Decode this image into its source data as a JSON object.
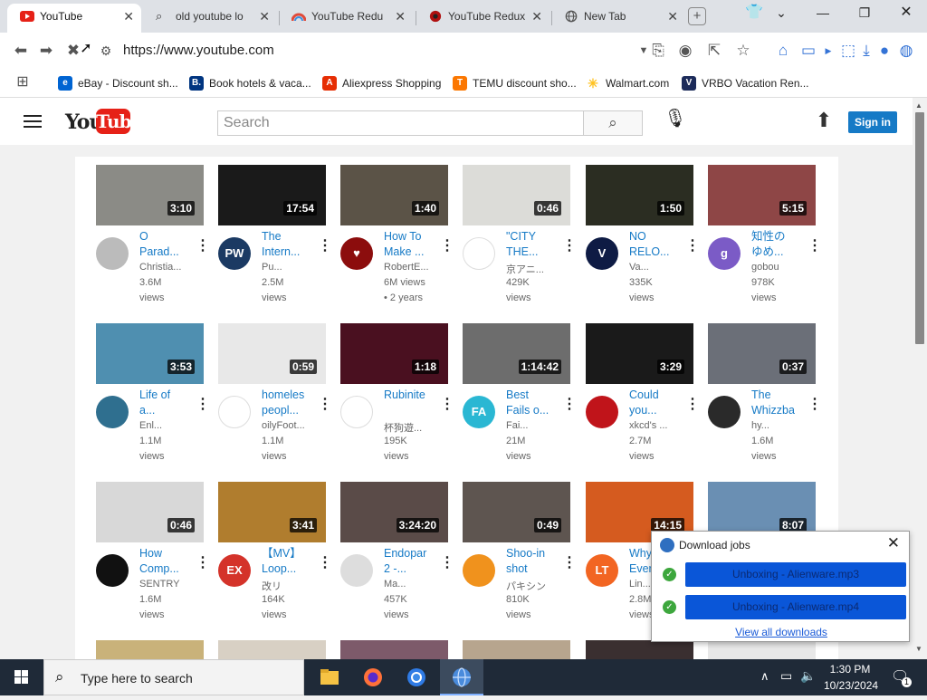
{
  "browser": {
    "tabs": [
      {
        "label": "YouTube",
        "active": true
      },
      {
        "label": "old youtube lo"
      },
      {
        "label": "YouTube Redu"
      },
      {
        "label": "YouTube Redux"
      },
      {
        "label": "New Tab"
      }
    ],
    "url": "https://www.youtube.com",
    "bookmarks": [
      {
        "label": "eBay - Discount sh...",
        "icon": "ebay-icon",
        "color": "#0064d2"
      },
      {
        "label": "Book hotels & vaca...",
        "icon": "booking-icon",
        "color": "#003580"
      },
      {
        "label": "Aliexpress Shopping",
        "icon": "aliexpress-icon",
        "color": "#e62e04"
      },
      {
        "label": "TEMU discount sho...",
        "icon": "temu-icon",
        "color": "#fb7701"
      },
      {
        "label": "Walmart.com",
        "icon": "walmart-icon",
        "color": "#ffc220"
      },
      {
        "label": "VRBO Vacation Ren...",
        "icon": "vrbo-icon",
        "color": "#1c2b5a"
      }
    ]
  },
  "youtube": {
    "logo_you": "You",
    "logo_tube": "Tube",
    "search_placeholder": "Search",
    "signin_label": "Sign in",
    "videos": [
      {
        "duration": "3:10",
        "title": "O\nParad...",
        "channel": "Christia...",
        "views": "3.6M",
        "views2": "views",
        "thumb": "#8b8b86",
        "avatar": "#bbbbbb",
        "avatar_text": ""
      },
      {
        "duration": "17:54",
        "title": "The\nIntern...",
        "channel": "Pu...",
        "views": "2.5M",
        "views2": "views",
        "thumb": "#1a1a1a",
        "avatar": "#1b3a63",
        "avatar_text": "PW"
      },
      {
        "duration": "1:40",
        "title": "How To\nMake ...",
        "channel": "RobertE...",
        "views": "6M views",
        "views2": "• 2 years",
        "thumb": "#5b5347",
        "avatar": "#8c0d0d",
        "avatar_text": "♥"
      },
      {
        "duration": "0:46",
        "title": "\"CITY\nTHE...",
        "channel": "京アニ...",
        "views": "429K",
        "views2": "views",
        "thumb": "#dcdcd8",
        "avatar": "#ffffff",
        "avatar_text": ""
      },
      {
        "duration": "1:50",
        "title": "NO\nRELO...",
        "channel": "Va...",
        "views": "335K",
        "views2": "views",
        "thumb": "#2b2d22",
        "avatar": "#0e1b44",
        "avatar_text": "V"
      },
      {
        "duration": "5:15",
        "title": "知性の\nゆめ...",
        "channel": "gobou",
        "views": "978K",
        "views2": "views",
        "thumb": "#8e4646",
        "avatar": "#7b5bc6",
        "avatar_text": "g"
      },
      {
        "duration": "3:53",
        "title": "Life of\na...",
        "channel": "Enl...",
        "views": "1.1M",
        "views2": "views",
        "thumb": "#4f8fb0",
        "avatar": "#2f6f8f",
        "avatar_text": ""
      },
      {
        "duration": "0:59",
        "title": "homeles\npeopl...",
        "channel": "oilyFoot...",
        "views": "1.1M",
        "views2": "views",
        "thumb": "#e8e8e8",
        "avatar": "#ffffff",
        "avatar_text": ""
      },
      {
        "duration": "1:18",
        "title": "Rubinite\n",
        "channel": "杯狗遊...",
        "views": "195K",
        "views2": "views",
        "thumb": "#4a1020",
        "avatar": "#ffffff",
        "avatar_text": ""
      },
      {
        "duration": "1:14:42",
        "title": "Best\nFails o...",
        "channel": "Fai...",
        "views": "21M",
        "views2": "views",
        "thumb": "#6d6d6d",
        "avatar": "#2ab7d3",
        "avatar_text": "FA"
      },
      {
        "duration": "3:29",
        "title": "Could\nyou...",
        "channel": "xkcd's ...",
        "views": "2.7M",
        "views2": "views",
        "thumb": "#1a1a1a",
        "avatar": "#c0141a",
        "avatar_text": ""
      },
      {
        "duration": "0:37",
        "title": "The\nWhizzba",
        "channel": "hy...",
        "views": "1.6M",
        "views2": "views",
        "thumb": "#6b6f78",
        "avatar": "#2a2a2a",
        "avatar_text": ""
      },
      {
        "duration": "0:46",
        "title": "How\nComp...",
        "channel": "SENTRY",
        "views": "1.6M",
        "views2": "views",
        "thumb": "#d8d8d8",
        "avatar": "#111111",
        "avatar_text": ""
      },
      {
        "duration": "3:41",
        "title": "【MV】\nLoop...",
        "channel": "改リ",
        "views": "164K",
        "views2": "views",
        "thumb": "#b07d2e",
        "avatar": "#d4332a",
        "avatar_text": "EX"
      },
      {
        "duration": "3:24:20",
        "title": "Endopar\n2 -...",
        "channel": "Ma...",
        "views": "457K",
        "views2": "views",
        "thumb": "#5a4b48",
        "avatar": "#dddddd",
        "avatar_text": ""
      },
      {
        "duration": "0:49",
        "title": "Shoo-in\nshot",
        "channel": "パキシン",
        "views": "810K",
        "views2": "views",
        "thumb": "#5e5550",
        "avatar": "#f0921d",
        "avatar_text": ""
      },
      {
        "duration": "14:15",
        "title": "Why\nEver...",
        "channel": "Lin...",
        "views": "2.8M",
        "views2": "views",
        "thumb": "#d55b1f",
        "avatar": "#f26522",
        "avatar_text": "LT"
      },
      {
        "duration": "8:07",
        "title": "",
        "channel": "",
        "views": "",
        "views2": "",
        "thumb": "#6a8fb3",
        "avatar": "",
        "avatar_text": ""
      }
    ]
  },
  "download_popup": {
    "title": "Download jobs",
    "jobs": [
      {
        "label": "Unboxing - Alienware.mp3"
      },
      {
        "label": "Unboxing - Alienware.mp4"
      }
    ],
    "link": "View all downloads"
  },
  "taskbar": {
    "search_placeholder": "Type here to search",
    "time": "1:30 PM",
    "date": "10/23/2024",
    "notification_count": "1"
  }
}
